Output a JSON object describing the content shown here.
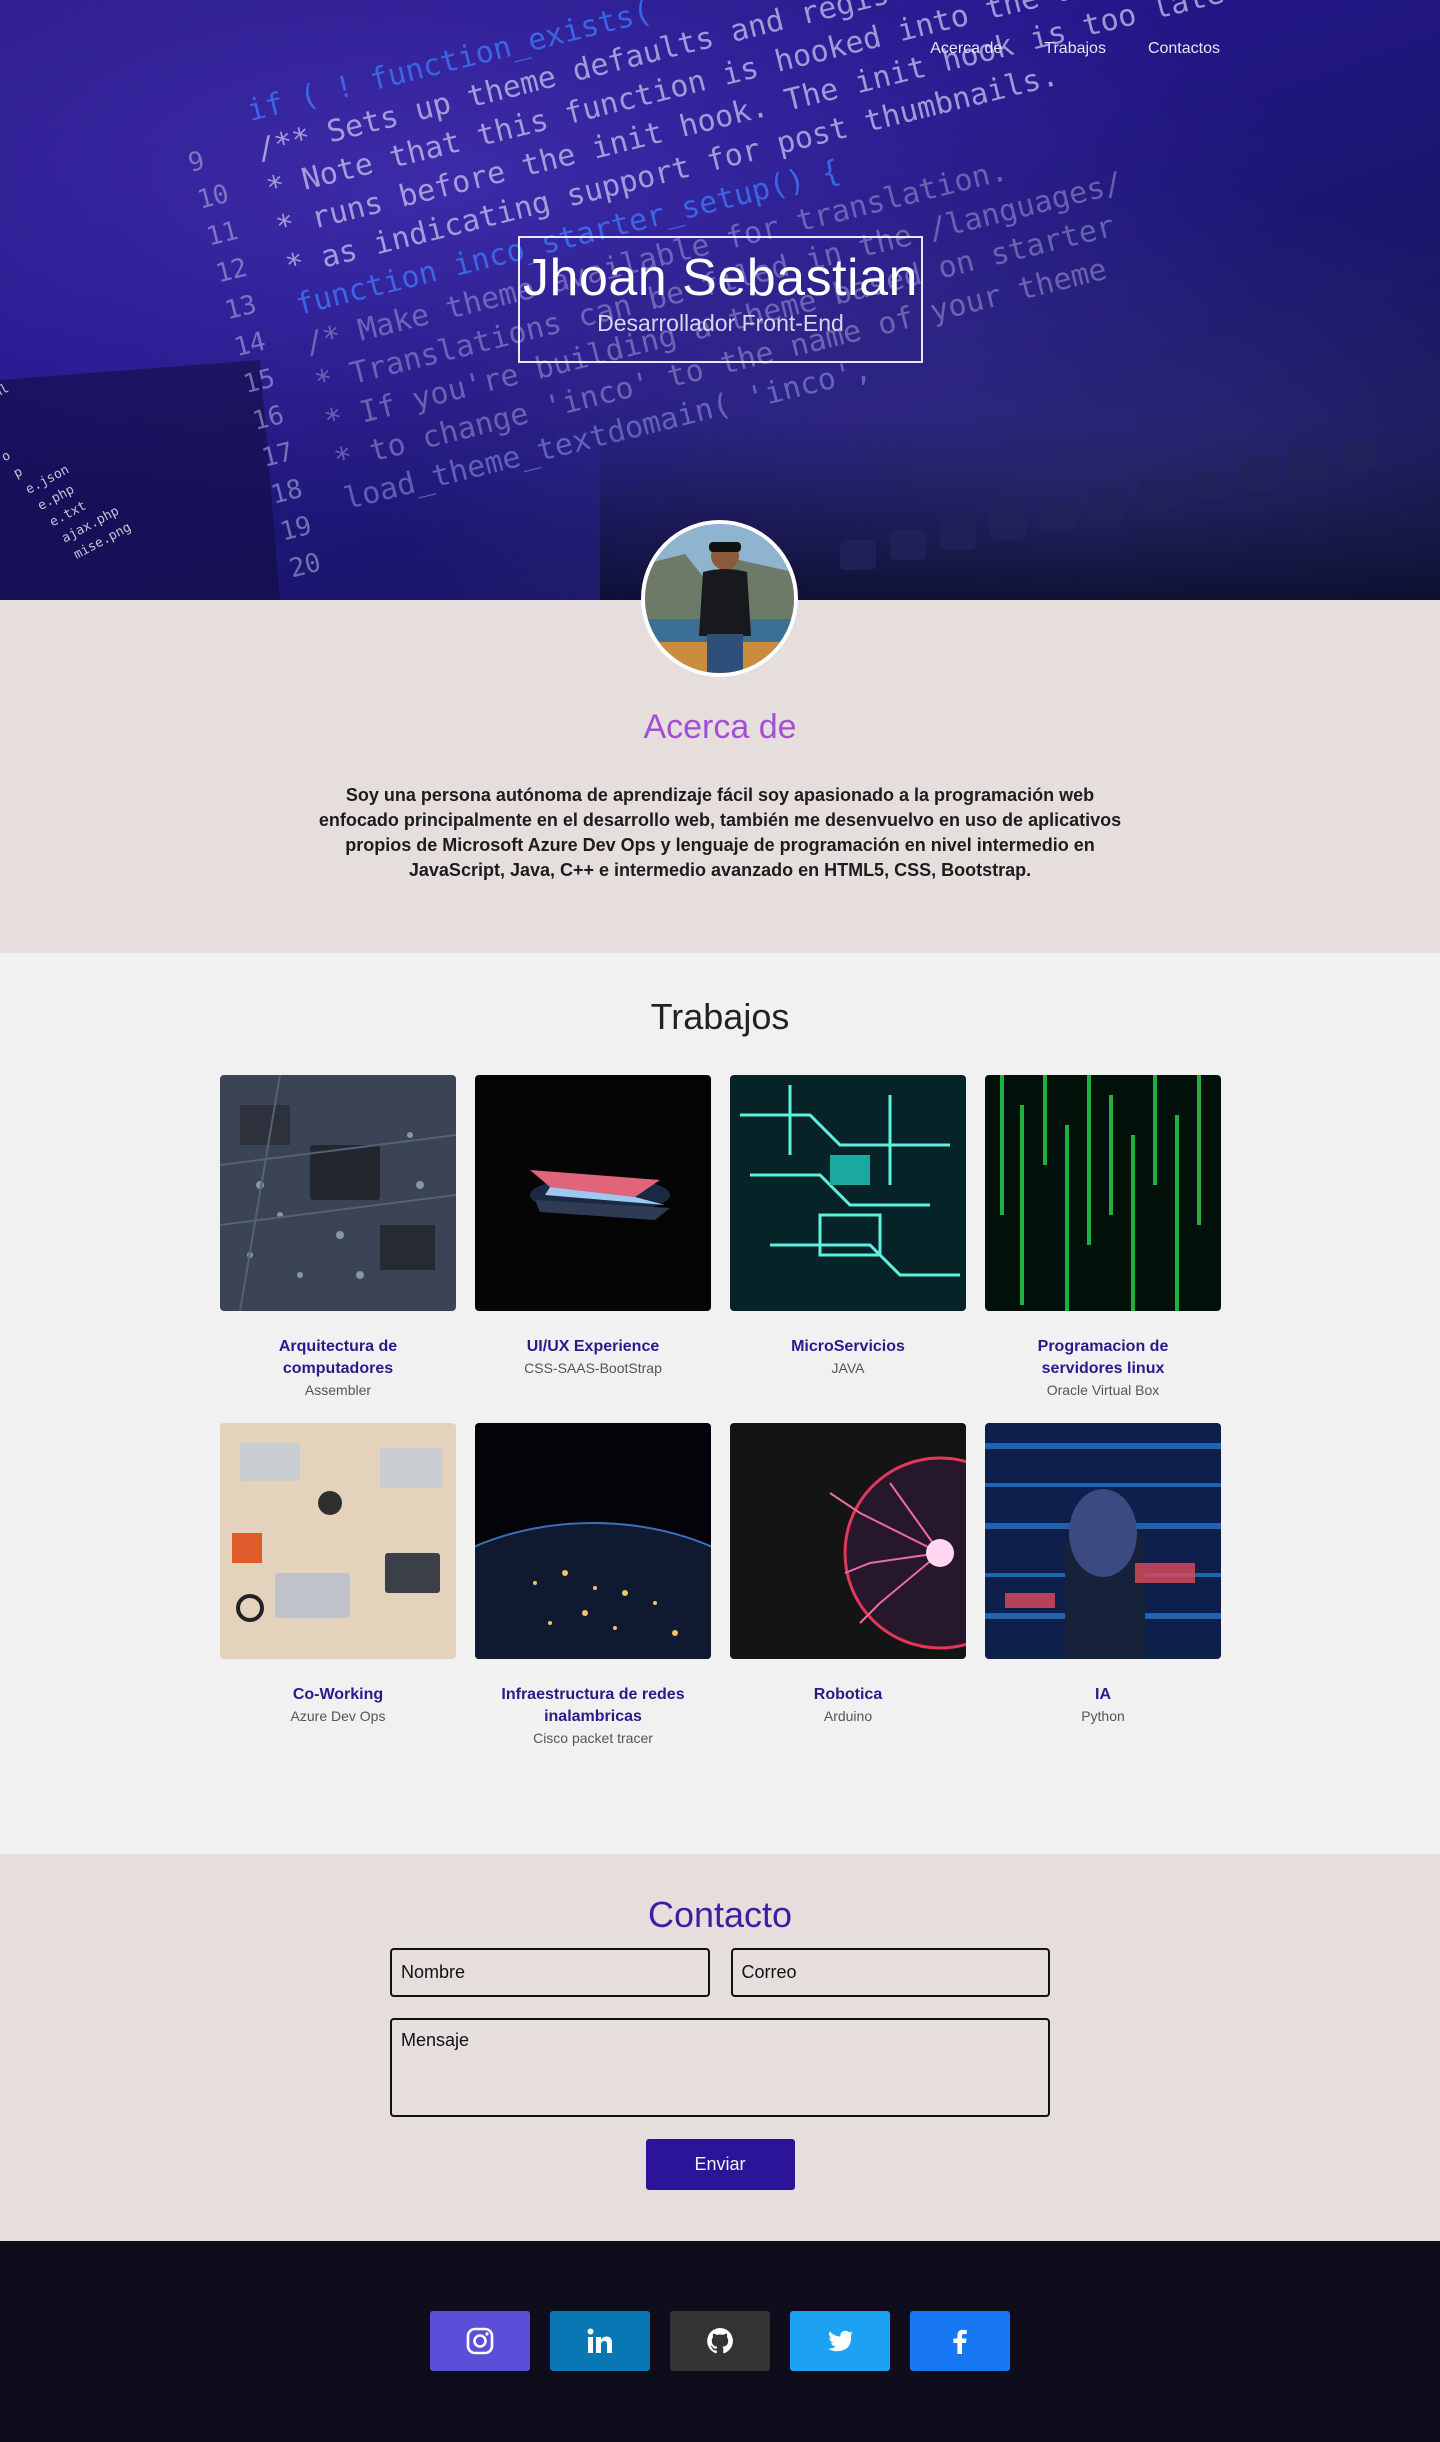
{
  "nav": {
    "items": [
      {
        "label": "Acerca de"
      },
      {
        "label": "Trabajos"
      },
      {
        "label": "Contactos"
      }
    ]
  },
  "hero": {
    "title": "Jhoan Sebastian",
    "subtitle": "Desarrollador Front-End",
    "code_lines": [
      "if ( ! function_exists(",
      "/** Sets up theme defaults and registers support",
      " * Note that this function is hooked into the after",
      " * runs before the init hook. The init hook is too late",
      " * as indicating support for post thumbnails.",
      "function inco_starter_setup() {",
      "  /* Make theme available for translation.",
      "   * Translations can be filed in the /languages/",
      "   * If you're building a theme based on starter",
      "   * to change 'inco' to the name of your theme",
      "   load_theme_textdomain( 'inco',"
    ],
    "line_numbers": [
      "9",
      "10",
      "11",
      "12",
      "13",
      "14",
      "15",
      "16",
      "17",
      "18",
      "19",
      "20"
    ],
    "file_names": [
      "st.xml",
      "p",
      "p",
      "o",
      "p",
      "e.json",
      "e.php",
      "e.txt",
      "ajax.php",
      "mise.png"
    ]
  },
  "about": {
    "heading": "Acerca de",
    "text": "Soy una persona autónoma de aprendizaje fácil soy apasionado a la programación web enfocado principalmente en el desarrollo web, también me desenvuelvo en uso de aplicativos propios de Microsoft Azure Dev Ops y lenguaje de programación en nivel intermedio en JavaScript, Java, C++ e intermedio avanzado en HTML5, CSS, Bootstrap."
  },
  "works": {
    "heading": "Trabajos",
    "items": [
      {
        "title": "Arquitectura de computadores",
        "subtitle": "Assembler",
        "image": "circuit-board"
      },
      {
        "title": "UI/UX Experience",
        "subtitle": "CSS-SAAS-BootStrap",
        "image": "laptop-glow"
      },
      {
        "title": "MicroServicios",
        "subtitle": "JAVA",
        "image": "cyan-circuit"
      },
      {
        "title": "Programacion de servidores linux",
        "subtitle": "Oracle Virtual Box",
        "image": "matrix-code"
      },
      {
        "title": "Co-Working",
        "subtitle": "Azure Dev Ops",
        "image": "desk-laptops"
      },
      {
        "title": "Infraestructura de redes inalambricas",
        "subtitle": "Cisco packet tracer",
        "image": "earth-night"
      },
      {
        "title": "Robotica",
        "subtitle": "Arduino",
        "image": "plasma-ball"
      },
      {
        "title": "IA",
        "subtitle": "Python",
        "image": "digital-face"
      }
    ]
  },
  "contact": {
    "heading": "Contacto",
    "name_placeholder": "Nombre",
    "email_placeholder": "Correo",
    "message_placeholder": "Mensaje",
    "submit_label": "Enviar"
  },
  "footer": {
    "socials": [
      {
        "name": "instagram",
        "icon": "instagram-icon",
        "color": "#5b4fd9"
      },
      {
        "name": "linkedin",
        "icon": "linkedin-icon",
        "color": "#0a77b5"
      },
      {
        "name": "github",
        "icon": "github-icon",
        "color": "#333333"
      },
      {
        "name": "twitter",
        "icon": "twitter-icon",
        "color": "#1da1f2"
      },
      {
        "name": "facebook",
        "icon": "facebook-icon",
        "color": "#1877f2"
      }
    ]
  },
  "colors": {
    "hero": "#23168a",
    "accent_purple": "#a24fd6",
    "work_title": "#2a1a8a",
    "contact_heading": "#3a1fa3",
    "button": "#2b1499",
    "about_bg": "#e5dedd",
    "works_bg": "#f1f1f1",
    "footer_bg": "#0f0d1c"
  }
}
